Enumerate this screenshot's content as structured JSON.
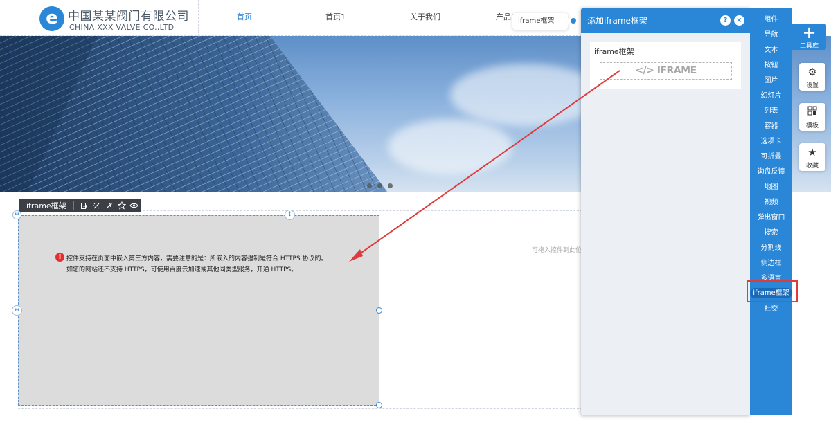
{
  "header": {
    "logo_mark": "e",
    "logo_cn": "中国某某阀门有限公司",
    "logo_en": "CHINA XXX VALVE CO.,LTD",
    "nav": [
      "首页",
      "首页1",
      "关于我们",
      "产品中心"
    ]
  },
  "component": {
    "toolbar_title": "iframe框架",
    "notice_icon": "!",
    "notice_line1": "控件支持在页面中嵌入第三方内容，需要注意的是：所嵌入的内容强制是符合 HTTPS 协议的。",
    "notice_line2": "如您的网站还不支持 HTTPS，可使用百度云加速或其他同类型服务，开通 HTTPS。",
    "drop_placeholder": "可拖入控件到此位置"
  },
  "tooltip": {
    "label": "iframe框架"
  },
  "add_panel": {
    "title": "添加iframe框架",
    "help_label": "?",
    "close_label": "×",
    "card_title": "iframe框架",
    "preview_label": "</> IFRAME"
  },
  "categories": [
    "组件",
    "导航",
    "文本",
    "按钮",
    "图片",
    "幻灯片",
    "列表",
    "容器",
    "选项卡",
    "可折叠",
    "询盘反馈",
    "地图",
    "视频",
    "弹出窗口",
    "搜索",
    "分割线",
    "侧边栏",
    "多语言",
    "iframe框架",
    "社交"
  ],
  "selected_category": "iframe框架",
  "rail": {
    "toolbox_label": "工具库",
    "settings_label": "设置",
    "template_label": "模板",
    "favorites_label": "收藏"
  },
  "colors": {
    "accent": "#2a86d6",
    "highlight": "#e03a3a",
    "notice": "#e62d2d",
    "toolbar_dark": "#3c3f45"
  },
  "icons": [
    "copy-icon",
    "magic-icon",
    "animation-icon",
    "star-icon",
    "eye-icon",
    "gear-icon",
    "grid-icon",
    "star-plus-icon",
    "plus-icon",
    "resize-vertical-icon",
    "resize-horizontal-icon"
  ]
}
